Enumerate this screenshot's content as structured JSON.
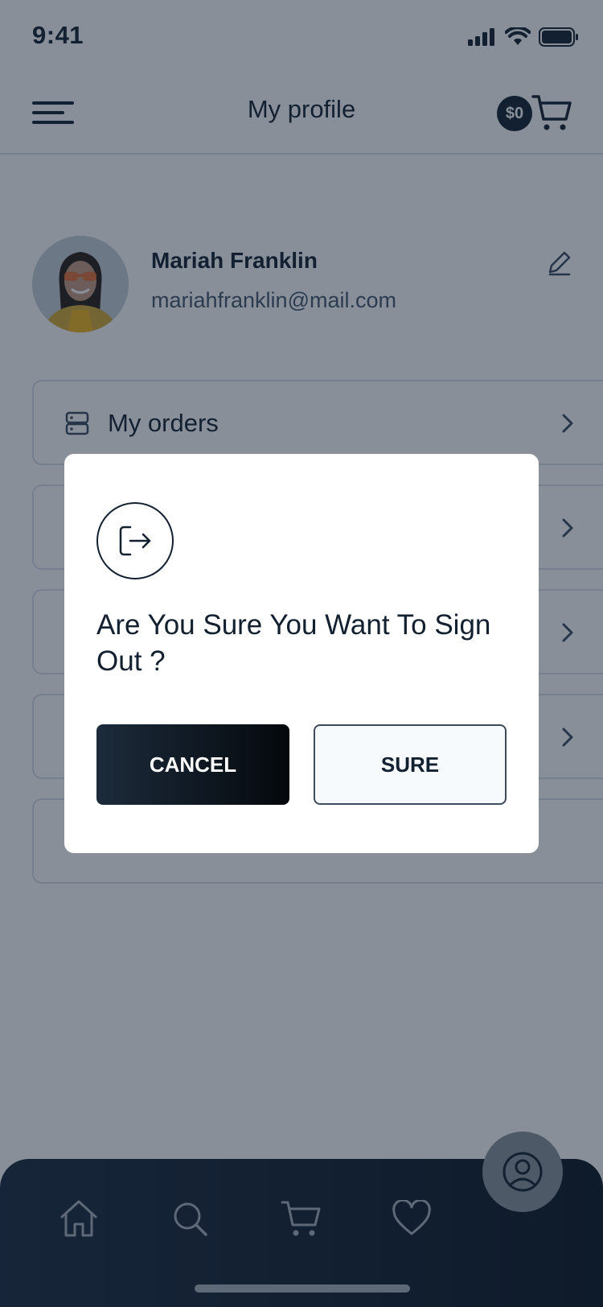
{
  "status_bar": {
    "time": "9:41"
  },
  "header": {
    "title": "My profile",
    "cart_badge": "$0"
  },
  "profile": {
    "name": "Mariah Franklin",
    "email": "mariahfranklin@mail.com"
  },
  "menu": {
    "items": [
      {
        "label": "My orders",
        "icon": "orders-icon"
      }
    ]
  },
  "bottom_nav": {
    "items": [
      "home-icon",
      "search-icon",
      "cart-icon",
      "heart-icon",
      "profile-icon"
    ],
    "active": "profile-icon"
  },
  "dialog": {
    "icon": "sign-out-icon",
    "title": "Are You Sure You Want To Sign Out ?",
    "cancel_label": "CANCEL",
    "confirm_label": "SURE"
  },
  "colors": {
    "dark": "#13202f",
    "nav_bg": "#1b2b3e",
    "overlay": "#122034",
    "border": "#d8dfe8"
  }
}
